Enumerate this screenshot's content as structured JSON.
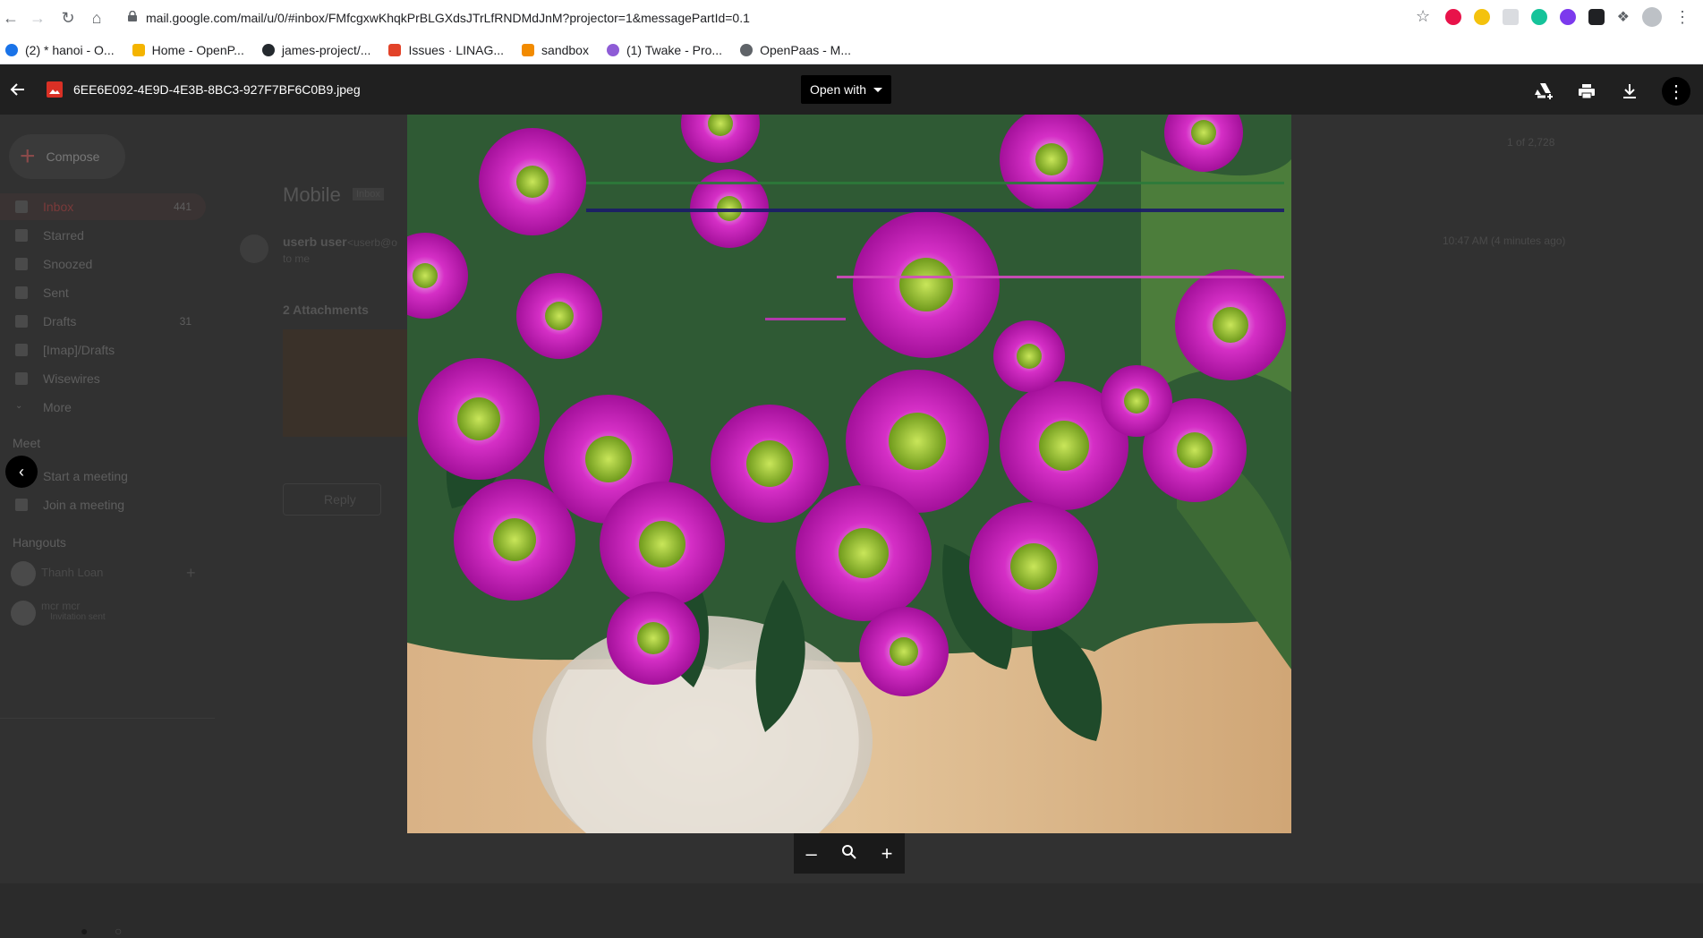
{
  "browser": {
    "url": "mail.google.com/mail/u/0/#inbox/FMfcgxwKhqkPrBLGXdsJTrLfRNDMdJnM?projector=1&messagePartId=0.1",
    "bookmarks": [
      {
        "label": "(2) * hanoi - O...",
        "color": "#1a73e8"
      },
      {
        "label": "Home - OpenP...",
        "color": "#f4b400"
      },
      {
        "label": "james-project/...",
        "color": "#24292e"
      },
      {
        "label": "Issues · LINAG...",
        "color": "#e24329"
      },
      {
        "label": "sandbox",
        "color": "#f28b00"
      },
      {
        "label": "(1) Twake - Pro...",
        "color": "#8e5cd6"
      },
      {
        "label": "OpenPaas - M...",
        "color": "#5f6368"
      }
    ],
    "extension_colors": [
      "#e8134a",
      "#f4c20d",
      "#dadce0",
      "#15c39a",
      "#7c3aed",
      "#202124",
      "#5f6368"
    ]
  },
  "viewer": {
    "file_name": "6EE6E092-4E9D-4E3B-8BC3-927F7BF6C0B9.jpeg",
    "open_with_label": "Open with",
    "icons": {
      "back": "arrow-left-icon",
      "file_type": "image-file-icon",
      "add_to_drive": "add-to-drive-icon",
      "print": "print-icon",
      "download": "download-icon",
      "more": "more-vert-icon",
      "zoom_out": "zoom-out-icon",
      "zoom_reset": "zoom-icon",
      "zoom_in": "zoom-in-icon"
    }
  },
  "gmail_background": {
    "compose_label": "Compose",
    "nav_items": [
      {
        "label": "Inbox",
        "count": "441",
        "active": true
      },
      {
        "label": "Starred",
        "count": ""
      },
      {
        "label": "Snoozed",
        "count": ""
      },
      {
        "label": "Sent",
        "count": ""
      },
      {
        "label": "Drafts",
        "count": "31"
      },
      {
        "label": "[Imap]/Drafts",
        "count": ""
      },
      {
        "label": "Wisewires",
        "count": ""
      },
      {
        "label": "More",
        "count": ""
      }
    ],
    "meet_heading": "Meet",
    "meet_items": [
      "Start a meeting",
      "Join a meeting"
    ],
    "hangouts_heading": "Hangouts",
    "hangout_users": [
      {
        "name": "Thanh Loan",
        "status": ""
      },
      {
        "name": "mcr mcr",
        "status": "Invitation sent"
      }
    ],
    "email_subject": "Mobile",
    "email_label": "Inbox",
    "sender": "userb user",
    "sender_email": "<userb@o",
    "to_me": "to me",
    "timestamp": "10:47 AM (4 minutes ago)",
    "attachments_heading": "2 Attachments",
    "reply_label": "Reply",
    "pagination": "1 of 2,728"
  }
}
